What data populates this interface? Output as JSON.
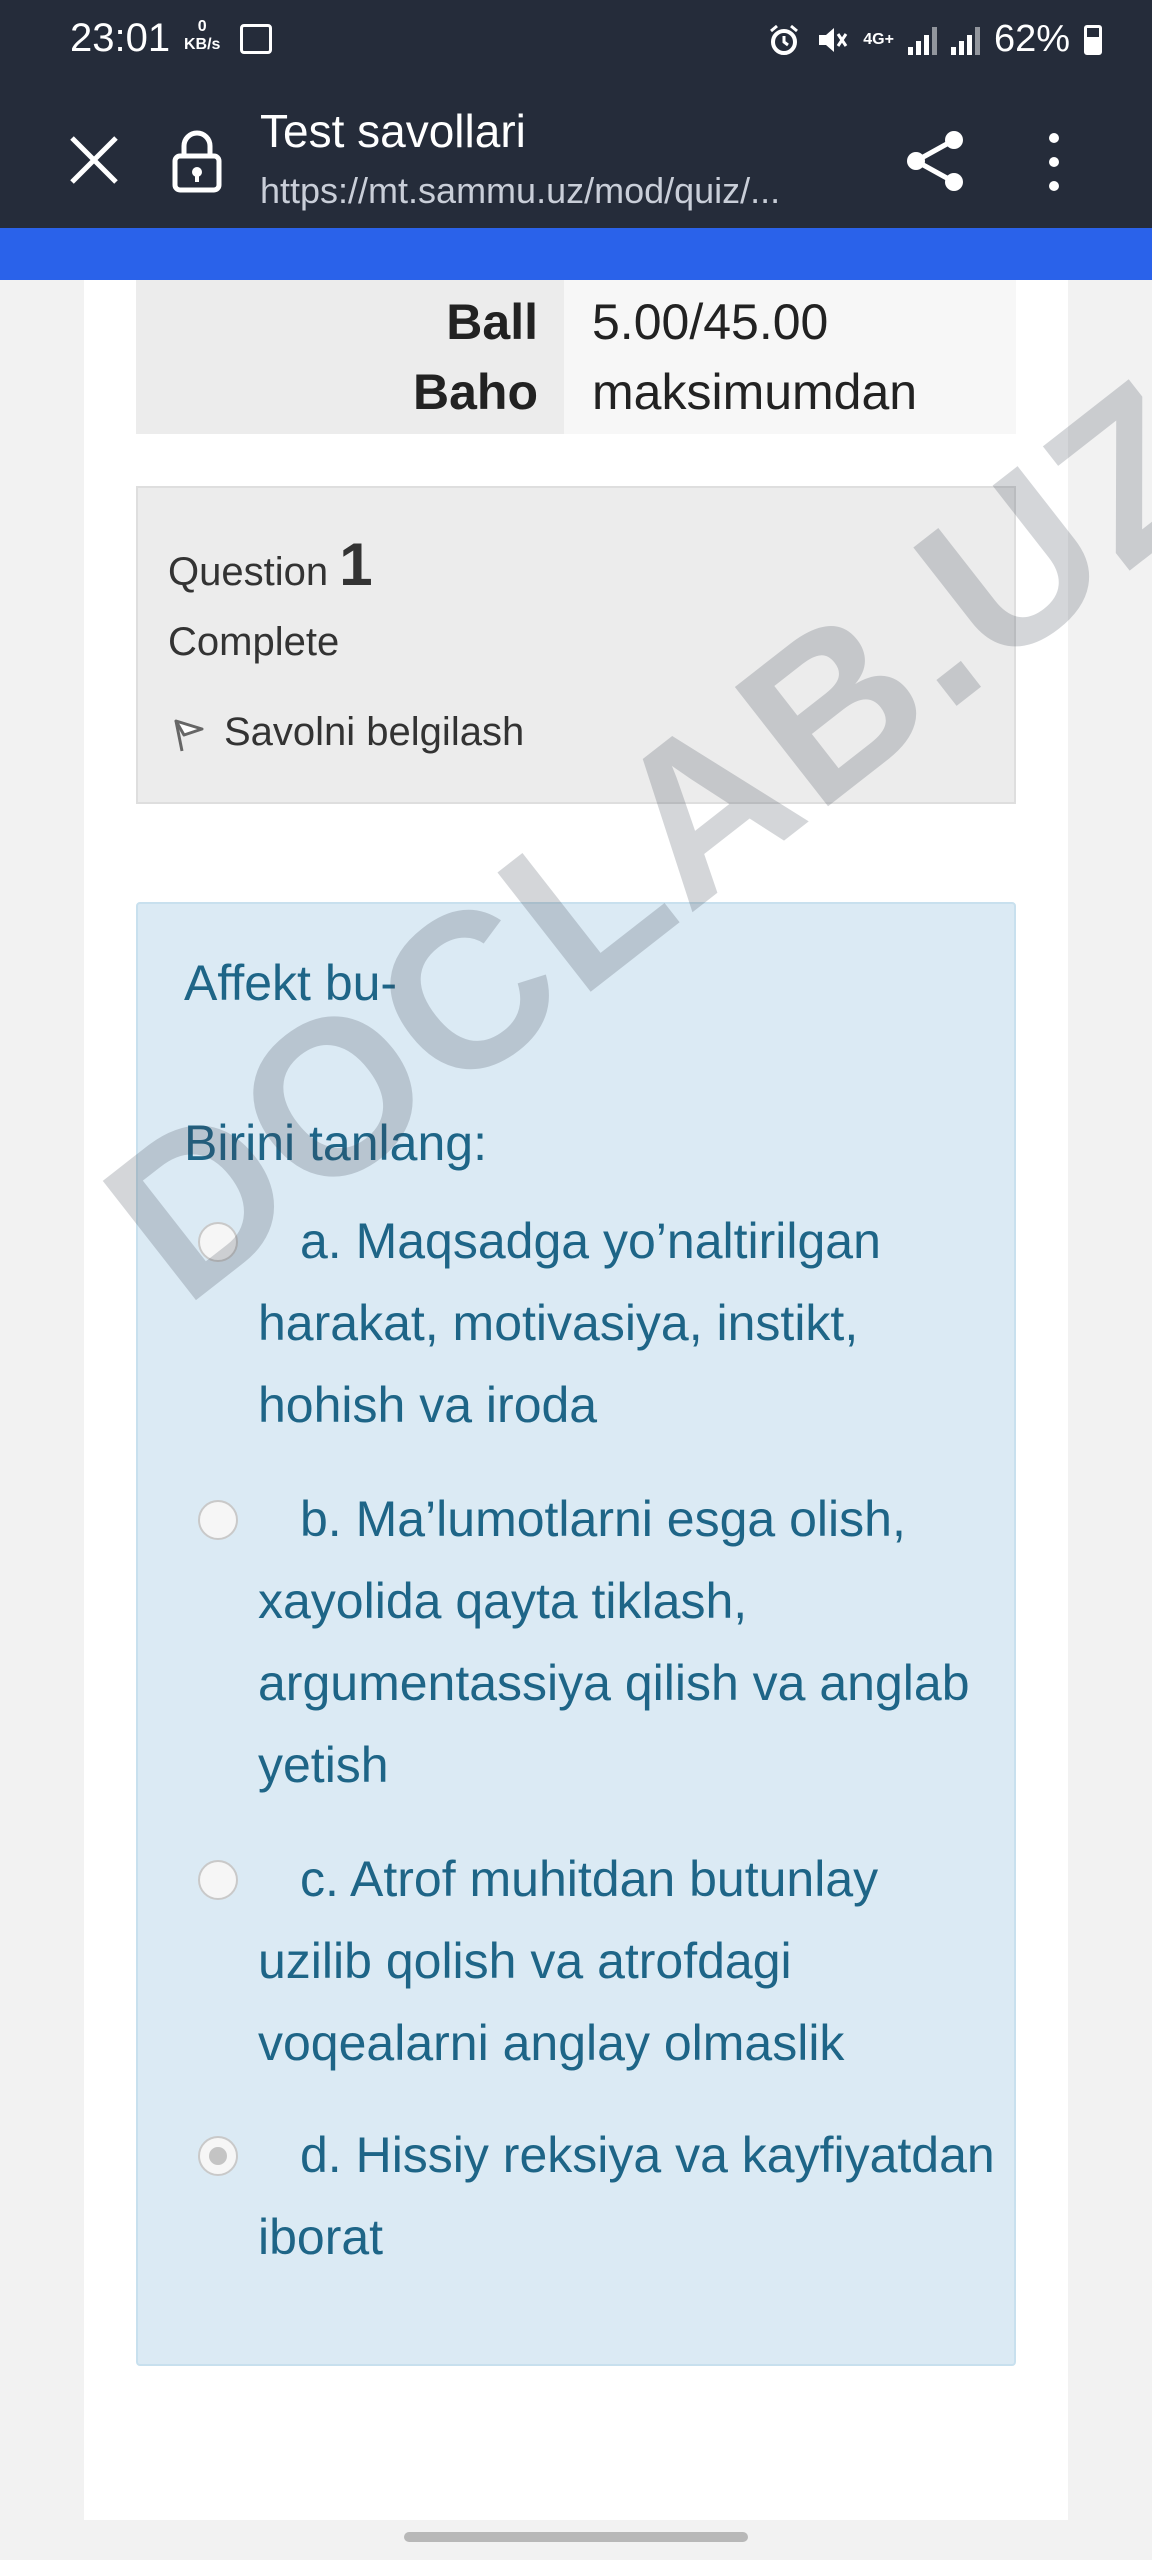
{
  "status_bar": {
    "time": "23:01",
    "net_speed_value": "0",
    "net_speed_unit": "KB/s",
    "network": "4G+",
    "battery": "62%"
  },
  "toolbar": {
    "title": "Test savollari",
    "url": "https://mt.sammu.uz/mod/quiz/..."
  },
  "summary": [
    {
      "label": "Ball",
      "value": "5.00/45.00"
    },
    {
      "label": "Baho",
      "value": "maksimumdan"
    }
  ],
  "question_info": {
    "label": "Question",
    "number": "1",
    "state": "Complete",
    "flag_label": "Savolni belgilash"
  },
  "question": {
    "text": "Affekt bu-",
    "prompt": "Birini tanlang:",
    "selected": "d",
    "answers": [
      {
        "letter": "a",
        "text": "a. Maqsadga yo’naltirilgan harakat, motivasiya, instikt, hohish va iroda"
      },
      {
        "letter": "b",
        "text": "b. Ma’lumotlarni esga olish, xayolida qayta tiklash, argumentassiya qilish va anglab yetish"
      },
      {
        "letter": "c",
        "text": "c. Atrof muhitdan butunlay uzilib qolish va atrofdagi voqealarni anglay olmaslik"
      },
      {
        "letter": "d",
        "text": "d. Hissiy reksiya va kayfiyatdan iborat"
      }
    ]
  },
  "watermark": "DOCLAB.UZ",
  "colors": {
    "toolbar_bg": "#252c3a",
    "progress_bar": "#2a62ea",
    "question_bg": "#dbeaf4",
    "question_text": "#1e6587"
  }
}
